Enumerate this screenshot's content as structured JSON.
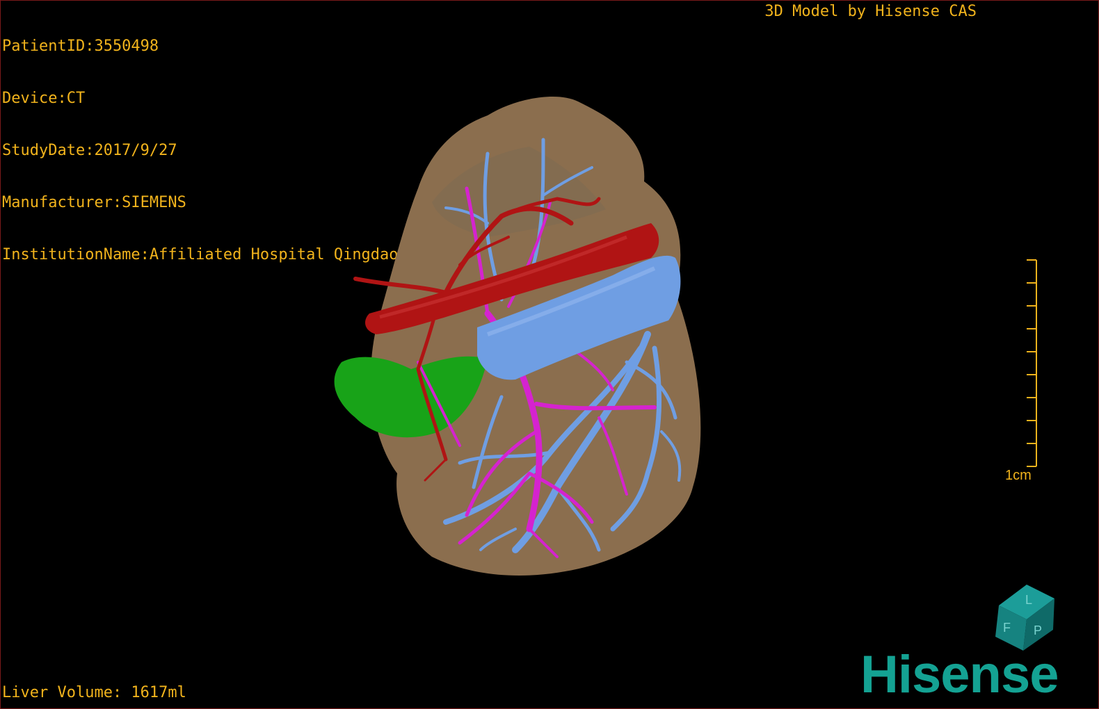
{
  "meta": {
    "patient_id": "PatientID:3550498",
    "device": "Device:CT",
    "study_date": "StudyDate:2017/9/27",
    "manufacturer": "Manufacturer:SIEMENS",
    "institution": "InstitutionName:Affiliated Hospital Qingdao University-C"
  },
  "brand_caption": "3D Model by Hisense CAS",
  "liver_volume": "Liver Volume: 1617ml",
  "scale_bar": {
    "label": "1cm"
  },
  "orientation_cube": {
    "face_letters": [
      "F",
      "L",
      "P"
    ]
  },
  "logo": {
    "text": "Hisense",
    "color": "#14a293"
  },
  "colors": {
    "overlay_text": "#f1b31c",
    "liver": "#8b6e4e",
    "artery": "#b01414",
    "portal_vein": "#d523cf",
    "hepatic_vein": "#6f9ee3",
    "gallbladder": "#18a318",
    "frame_border": "#7a1a1a"
  }
}
